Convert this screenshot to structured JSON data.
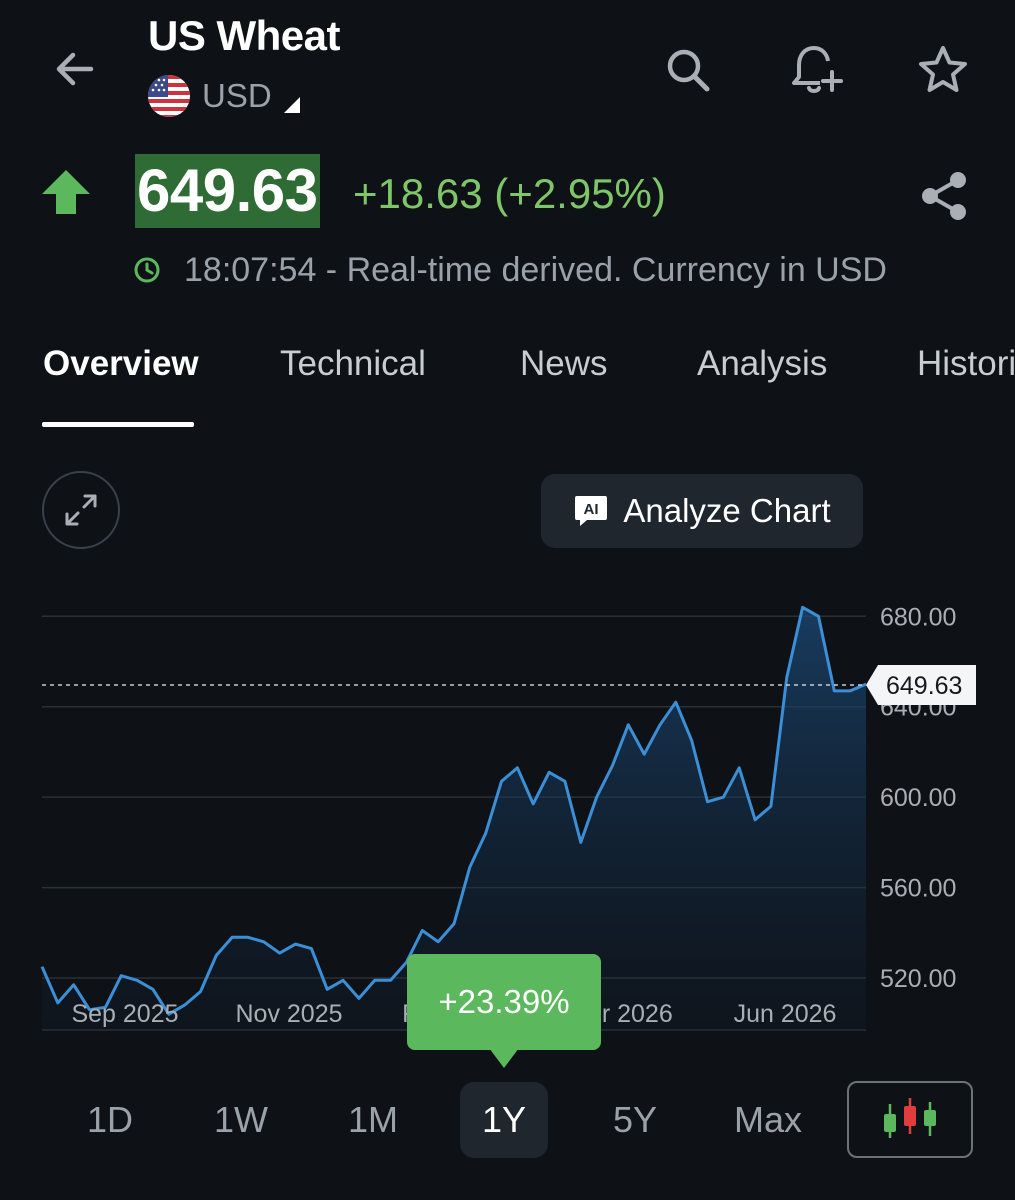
{
  "header": {
    "title": "US Wheat",
    "currency": "USD",
    "icons": [
      "back-arrow-icon",
      "us-flag-icon",
      "dropdown-triangle-icon",
      "search-icon",
      "bell-plus-icon",
      "star-icon"
    ]
  },
  "quote": {
    "price": "649.63",
    "change": "+18.63 (+2.95%)",
    "timestamp": "18:07:54 - Real-time derived. Currency in USD",
    "up_color": "#5cb85c",
    "icons": [
      "up-arrow-icon",
      "share-icon",
      "clock-icon"
    ]
  },
  "tabs": [
    {
      "label": "Overview",
      "active": true
    },
    {
      "label": "Technical"
    },
    {
      "label": "News"
    },
    {
      "label": "Analysis"
    },
    {
      "label": "Historical"
    }
  ],
  "toolbar": {
    "analyze_label": "Analyze Chart",
    "icons": [
      "expand-icon",
      "ai-icon"
    ]
  },
  "performance": "+23.39%",
  "ranges": [
    {
      "label": "1D"
    },
    {
      "label": "1W"
    },
    {
      "label": "1M"
    },
    {
      "label": "1Y",
      "active": true
    },
    {
      "label": "5Y"
    },
    {
      "label": "Max"
    }
  ],
  "chart_type_icon": "candlestick-icon",
  "chart_data": {
    "type": "area",
    "x_ticks": [
      "Sep 2025",
      "Nov 2025",
      "Feb 2026",
      "Apr 2026",
      "Jun 2026"
    ],
    "y_ticks": [
      "520.00",
      "560.00",
      "600.00",
      "640.00",
      "680.00"
    ],
    "ylim": [
      497,
      685
    ],
    "last_value_label": "649.63",
    "line_color": "#3b8fd6",
    "series": [
      {
        "values": [
          525,
          509,
          517,
          506,
          507,
          521,
          519,
          515,
          504,
          508,
          514,
          530,
          538,
          538,
          536,
          531,
          535,
          533,
          515,
          519,
          511,
          519,
          519,
          527,
          541,
          536,
          544,
          569,
          584,
          607,
          613,
          597,
          611,
          607,
          580,
          600,
          614,
          632,
          619,
          632,
          642,
          625,
          598,
          600,
          613,
          590,
          596,
          653,
          684,
          680,
          647,
          647,
          650
        ]
      }
    ]
  }
}
